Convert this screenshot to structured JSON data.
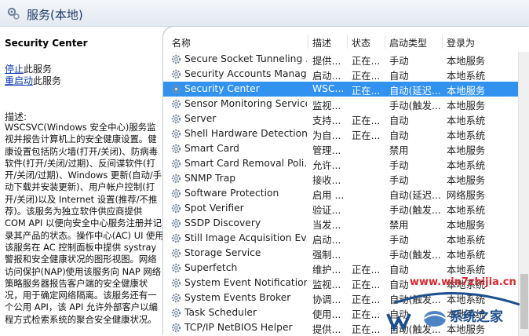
{
  "window": {
    "title": "服务(本地)"
  },
  "left_pane": {
    "service_name": "Security Center",
    "stop_link": "停止",
    "stop_suffix": "此服务",
    "restart_link": "重启动",
    "restart_suffix": "此服务",
    "description_label": "描述:",
    "description": "WSCSVC(Windows 安全中心)服务监视并报告计算机上的安全健康设置。健康设置包括防火墙(打开/关闭)、防病毒软件(打开/关闭/过期)、反间谍软件(打开/关闭/过期)、Windows 更新(自动/手动下载并安装更新)、用户帐户控制(打开/关闭)以及 Internet 设置(推荐/不推荐)。该服务为独立软件供应商提供 COM API 以便向安全中心服务注册并记录其产品的状态。操作中心(AC) UI 使用该服务在 AC 控制面板中提供 systray 警报和安全健康状况的图形视图。网络访问保护(NAP)使用该服务向 NAP 网络策略服务器报告客户端的安全健康状况，用于确定网络隔离。该服务还有一个公用 API，该 API 允许外部客户以编程方式检索系统的聚合安全健康状况。"
  },
  "columns": {
    "name": "名称",
    "desc": "描述",
    "status": "状态",
    "startup": "启动类型",
    "logon": "登录为"
  },
  "rows": [
    {
      "name": "Secure Socket Tunneling ...",
      "desc": "提供...",
      "status": "正在...",
      "startup": "手动",
      "logon": "本地服务"
    },
    {
      "name": "Security Accounts Manag...",
      "desc": "启动...",
      "status": "正在...",
      "startup": "自动",
      "logon": "本地系统"
    },
    {
      "name": "Security Center",
      "desc": "WSC...",
      "status": "正在...",
      "startup": "自动(延迟...",
      "logon": "本地服务"
    },
    {
      "name": "Sensor Monitoring Service",
      "desc": "监视...",
      "status": "",
      "startup": "手动(触发...",
      "logon": "本地服务"
    },
    {
      "name": "Server",
      "desc": "支持...",
      "status": "正在...",
      "startup": "自动",
      "logon": "本地系统"
    },
    {
      "name": "Shell Hardware Detection",
      "desc": "为自...",
      "status": "正在...",
      "startup": "自动",
      "logon": "本地系统"
    },
    {
      "name": "Smart Card",
      "desc": "管理...",
      "status": "",
      "startup": "禁用",
      "logon": "本地服务"
    },
    {
      "name": "Smart Card Removal Poli...",
      "desc": "允许...",
      "status": "",
      "startup": "手动",
      "logon": "本地系统"
    },
    {
      "name": "SNMP Trap",
      "desc": "接收...",
      "status": "",
      "startup": "手动",
      "logon": "本地服务"
    },
    {
      "name": "Software Protection",
      "desc": "启用 ...",
      "status": "",
      "startup": "自动(延迟...",
      "logon": "网络服务"
    },
    {
      "name": "Spot Verifier",
      "desc": "验证...",
      "status": "",
      "startup": "手动(触发...",
      "logon": "本地系统"
    },
    {
      "name": "SSDP Discovery",
      "desc": "当发...",
      "status": "",
      "startup": "禁用",
      "logon": "本地服务"
    },
    {
      "name": "Still Image Acquisition Ev...",
      "desc": "启动...",
      "status": "",
      "startup": "手动",
      "logon": "本地系统"
    },
    {
      "name": "Storage Service",
      "desc": "强制...",
      "status": "",
      "startup": "手动(触发...",
      "logon": "本地系统"
    },
    {
      "name": "Superfetch",
      "desc": "维护...",
      "status": "正在...",
      "startup": "自动",
      "logon": "本地系统"
    },
    {
      "name": "System Event Notification...",
      "desc": "监视...",
      "status": "正在...",
      "startup": "自动",
      "logon": "本地系统"
    },
    {
      "name": "System Events Broker",
      "desc": "协调...",
      "status": "正在...",
      "startup": "自动(触发...",
      "logon": "本地系统"
    },
    {
      "name": "Task Scheduler",
      "desc": "使用...",
      "status": "正在...",
      "startup": "自动",
      "logon": "本地系统"
    },
    {
      "name": "TCP/IP NetBIOS Helper",
      "desc": "提供...",
      "status": "正在...",
      "startup": "自动(触发...",
      "logon": "本地服务"
    }
  ],
  "selected_row": 2,
  "watermark": {
    "url": "www.win7zhijia.cn",
    "text": "系统之家"
  },
  "colors": {
    "selection": "#3292f0",
    "link": "#0b3bb0",
    "header_title": "#1e3a66"
  },
  "icons": {
    "header": "services-gear-icon",
    "row": "gear-icon"
  }
}
